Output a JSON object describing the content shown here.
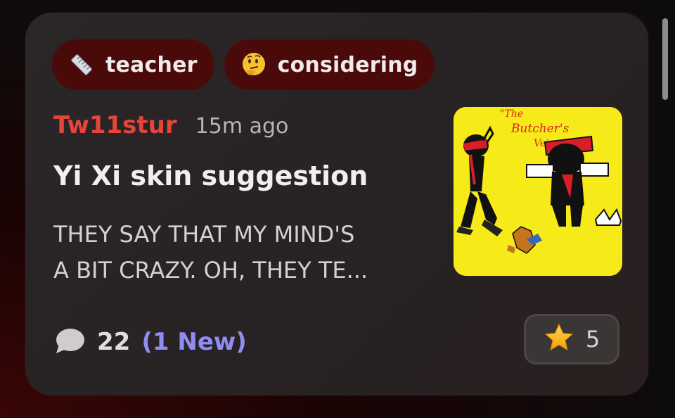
{
  "tags": [
    {
      "icon": "ruler-icon",
      "label": "teacher"
    },
    {
      "icon": "thinking-face-icon",
      "label": "considering"
    }
  ],
  "post": {
    "author": "Tw11stur",
    "time": "15m ago",
    "title": "Yi Xi skin suggestion",
    "body_lines": [
      "THEY SAY THAT MY MIND'S",
      "A BIT CRAZY. OH, THEY TE..."
    ],
    "thumbnail_caption": "\"The Butcher's Vein\""
  },
  "footer": {
    "comments": "22",
    "new_comments": "(1 New)",
    "reaction_icon": "star-icon",
    "reaction_count": "5"
  },
  "colors": {
    "tag_bg": "#4a0a0a",
    "author": "#e5453a",
    "new_badge": "#8f8cf2",
    "thumbnail_bg": "#f6ea19"
  }
}
